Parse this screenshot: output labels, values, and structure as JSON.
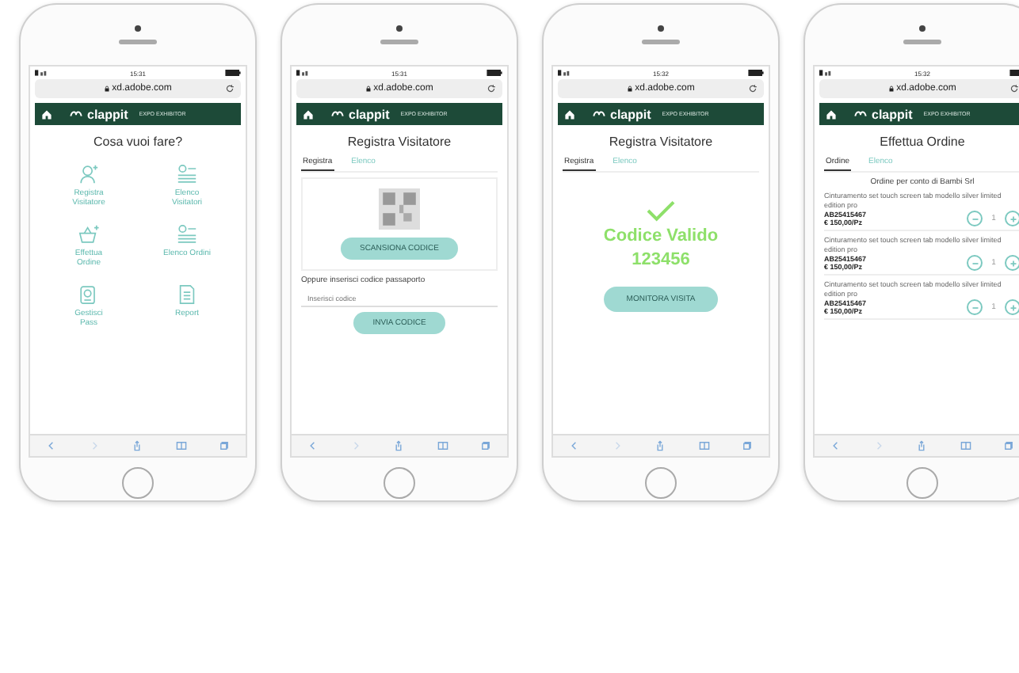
{
  "phones": [
    {
      "status_time": "15:31",
      "url": "xd.adobe.com",
      "brand": "clappit",
      "brand_tag": "EXPO EXHIBITOR",
      "screen": {
        "kind": "menu",
        "title": "Cosa vuoi fare?",
        "items": [
          {
            "kind": "person",
            "label": "Registra Visitatore"
          },
          {
            "kind": "list",
            "label": "Elenco Visitatori"
          },
          {
            "kind": "basket",
            "label": "Effettua Ordine"
          },
          {
            "kind": "list",
            "label": "Elenco Ordini"
          },
          {
            "kind": "pass",
            "label": "Gestisci Pass"
          },
          {
            "kind": "report",
            "label": "Report"
          }
        ]
      }
    },
    {
      "status_time": "15:31",
      "url": "xd.adobe.com",
      "brand": "clappit",
      "brand_tag": "EXPO EXHIBITOR",
      "screen": {
        "kind": "register",
        "title": "Registra Visitatore",
        "tabs": [
          {
            "label": "Registra",
            "selected": true
          },
          {
            "label": "Elenco",
            "selected": false
          }
        ],
        "scan_button": "SCANSIONA CODICE",
        "manual_label": "Oppure inserisci codice passaporto",
        "placeholder": "Inserisci codice",
        "submit_button": "INVIA CODICE"
      }
    },
    {
      "status_time": "15:32",
      "url": "xd.adobe.com",
      "brand": "clappit",
      "brand_tag": "EXPO EXHIBITOR",
      "screen": {
        "kind": "result",
        "title": "Registra Visitatore",
        "tabs": [
          {
            "label": "Registra",
            "selected": true
          },
          {
            "label": "Elenco",
            "selected": false
          }
        ],
        "status": "Codice Valido",
        "code": "123456",
        "button": "MONITORA VISITA"
      }
    },
    {
      "status_time": "15:32",
      "url": "xd.adobe.com",
      "brand": "clappit",
      "brand_tag": "EXPO EXHIBITOR",
      "screen": {
        "kind": "order",
        "title": "Effettua Ordine",
        "tabs": [
          {
            "label": "Ordine",
            "selected": true
          },
          {
            "label": "Elenco",
            "selected": false
          }
        ],
        "subtitle": "Ordine per conto di Bambi Srl",
        "products": [
          {
            "description": "Cinturamento set touch screen tab modello silver limited edition pro",
            "code": "AB25415467",
            "price": "€ 150,00/Pz",
            "quantity": "1"
          },
          {
            "description": "Cinturamento set touch screen tab modello silver limited edition pro",
            "code": "AB25415467",
            "price": "€ 150,00/Pz",
            "quantity": "1"
          },
          {
            "description": "Cinturamento set touch screen tab modello silver limited edition pro",
            "code": "AB25415467",
            "price": "€ 150,00/Pz",
            "quantity": "1"
          }
        ]
      }
    }
  ]
}
